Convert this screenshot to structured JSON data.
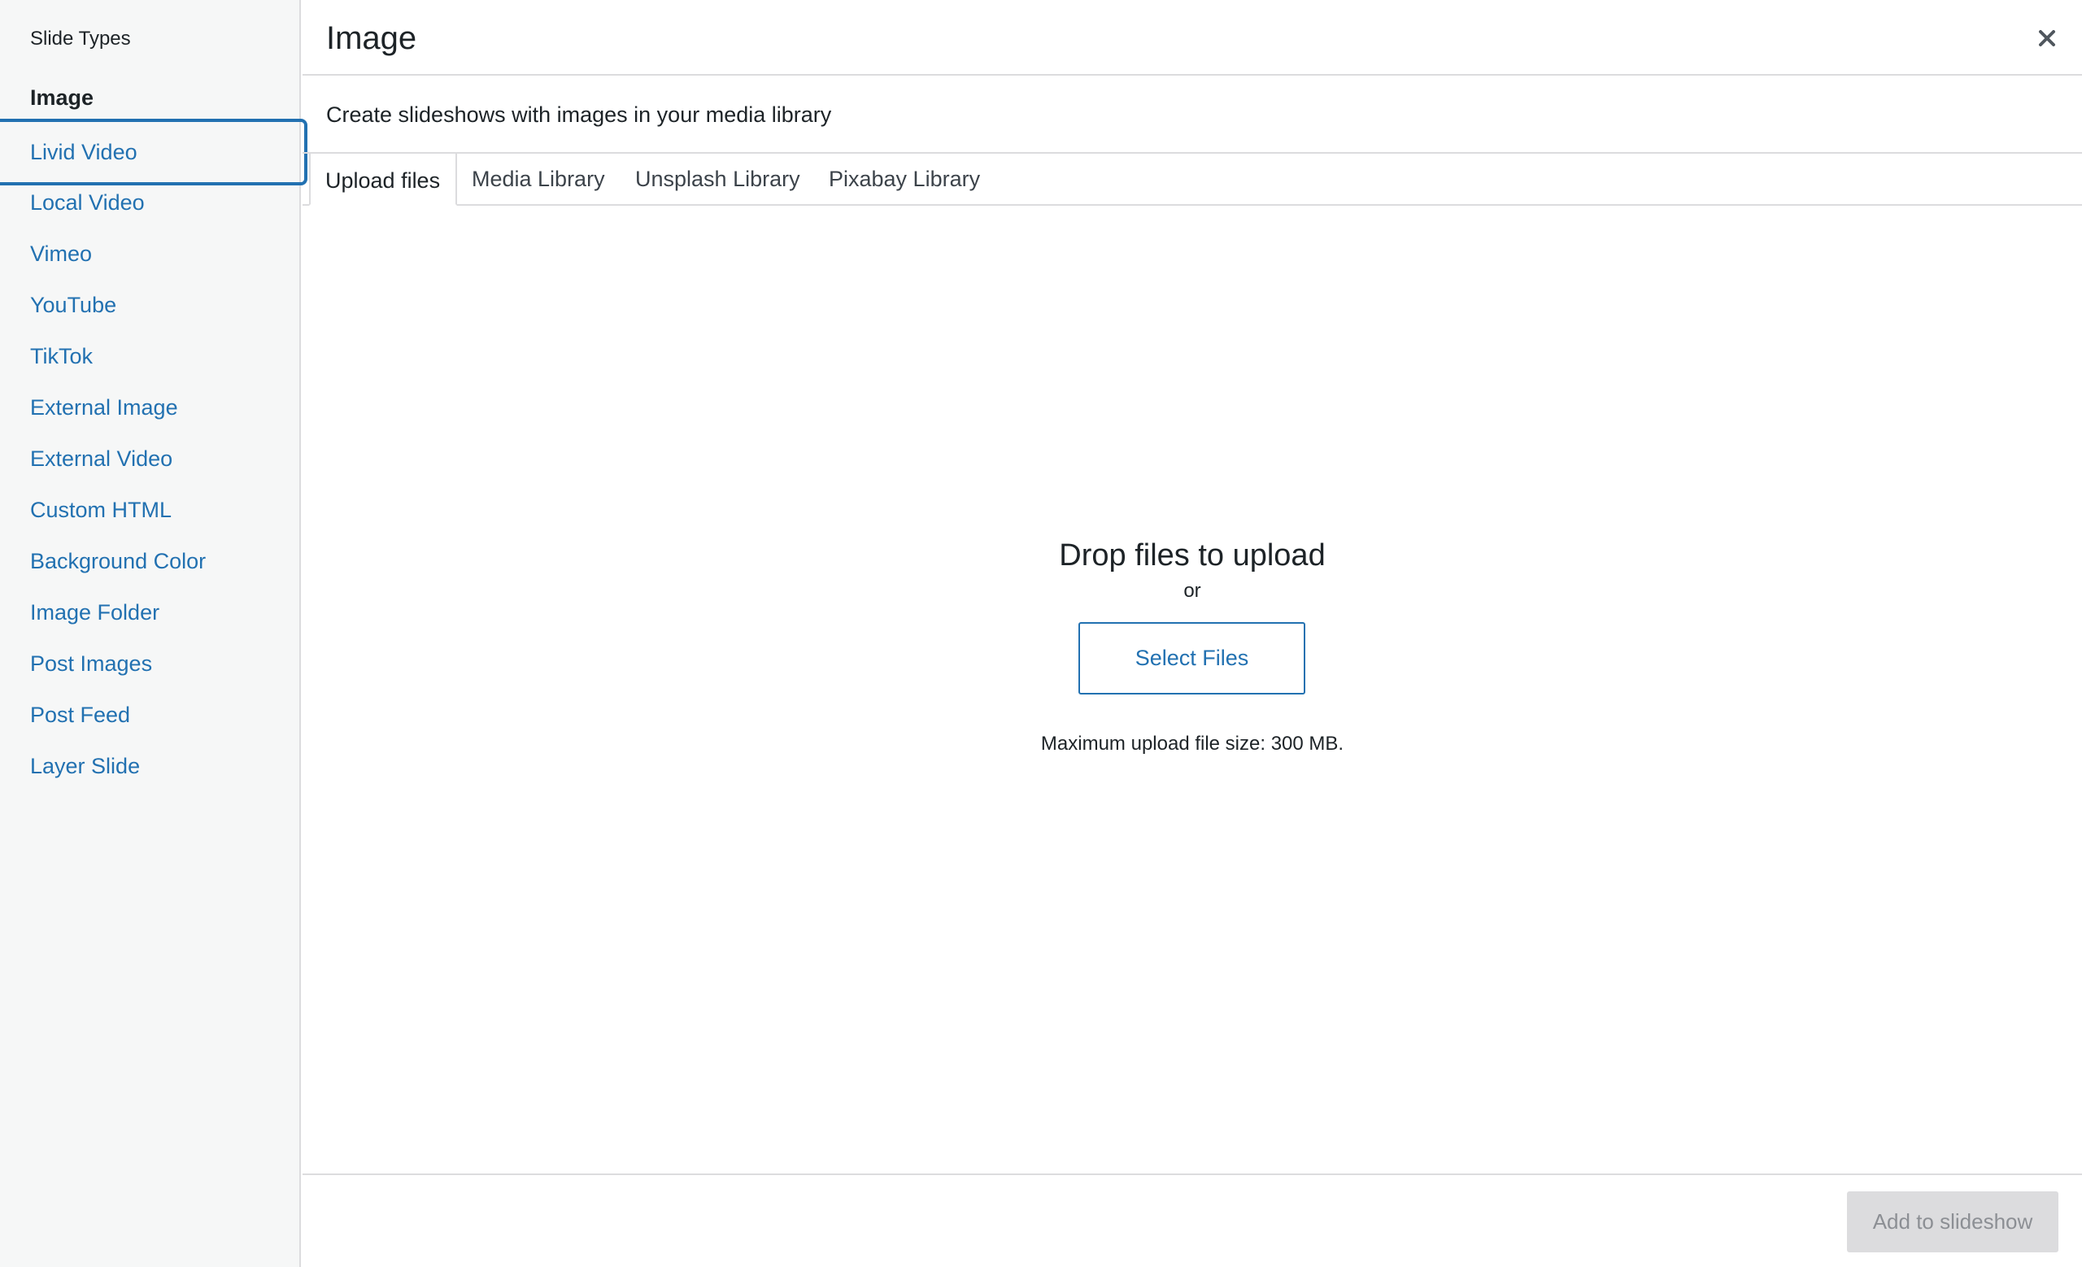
{
  "sidebar": {
    "heading": "Slide Types",
    "items": [
      {
        "label": "Image"
      },
      {
        "label": "Livid Video"
      },
      {
        "label": "Local Video"
      },
      {
        "label": "Vimeo"
      },
      {
        "label": "YouTube"
      },
      {
        "label": "TikTok"
      },
      {
        "label": "External Image"
      },
      {
        "label": "External Video"
      },
      {
        "label": "Custom HTML"
      },
      {
        "label": "Background Color"
      },
      {
        "label": "Image Folder"
      },
      {
        "label": "Post Images"
      },
      {
        "label": "Post Feed"
      },
      {
        "label": "Layer Slide"
      }
    ],
    "active_item": "Image",
    "focused_item": "Livid Video"
  },
  "header": {
    "title": "Image",
    "close_icon": "close-icon"
  },
  "main": {
    "description": "Create slideshows with images in your media library",
    "tabs": [
      {
        "label": "Upload files"
      },
      {
        "label": "Media Library"
      },
      {
        "label": "Unsplash Library"
      },
      {
        "label": "Pixabay Library"
      }
    ],
    "active_tab": "Upload files",
    "upload": {
      "drop_title": "Drop files to upload",
      "or_text": "or",
      "select_button": "Select Files",
      "max_size": "Maximum upload file size: 300 MB."
    }
  },
  "footer": {
    "add_button": "Add to slideshow",
    "add_button_disabled": true
  },
  "colors": {
    "accent": "#2271b1",
    "sidebar_bg": "#f6f7f7",
    "border": "#dcdcde",
    "text": "#1d2327",
    "disabled_text": "#8c8f94"
  }
}
